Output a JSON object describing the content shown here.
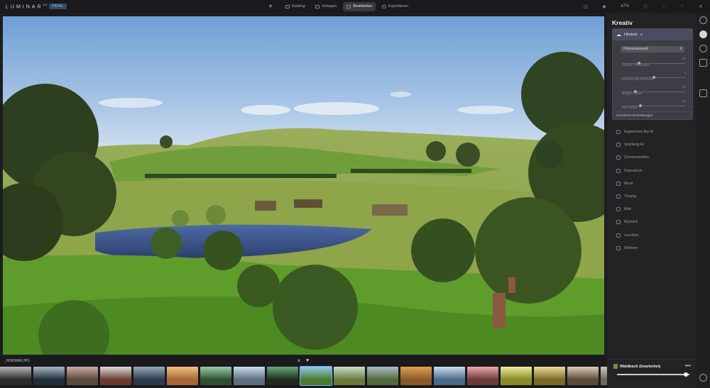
{
  "app": {
    "logo": "LUMINAR",
    "version": "4.3",
    "trial_badge": "TRIAL"
  },
  "topnav": {
    "add_label": "+",
    "tabs": [
      {
        "label": "Katalog"
      },
      {
        "label": "Vorlagen"
      },
      {
        "label": "Bearbeiten",
        "active": true
      },
      {
        "label": "Exportieren"
      }
    ]
  },
  "toolbar_right": {
    "zoom": "47%"
  },
  "filmstrip": {
    "filename": "_HDR3849.JPG",
    "close_label": "✕",
    "heart_label": "♥",
    "thumb_count": 19,
    "selected_index": 9
  },
  "panel": {
    "title": "Kreativ",
    "sky_module": {
      "title": "Himmel",
      "title_ai": "AI",
      "select_value": "Himmelauswahl",
      "sliders": [
        {
          "label": "Himmel Verblenden",
          "value": "25",
          "fraction": 0.25
        },
        {
          "label": "Position des Horizonts",
          "value": "0",
          "fraction": 0.5
        },
        {
          "label": "Relight Szene",
          "value": "20",
          "fraction": 0.2
        },
        {
          "label": "Sky Global",
          "value": "20",
          "fraction": 0.28
        }
      ],
      "advanced_label": "Erweiterte Einstellungen"
    },
    "tools": [
      {
        "label": "Augmented Sky AI"
      },
      {
        "label": "Strahlung AI"
      },
      {
        "label": "Sonnenstrahlen"
      },
      {
        "label": "Dramatisch"
      },
      {
        "label": "Mood"
      },
      {
        "label": "Tönung"
      },
      {
        "label": "Matt"
      },
      {
        "label": "Mystisch"
      },
      {
        "label": "Leuchten"
      },
      {
        "label": "Filmkorn"
      }
    ],
    "preset": {
      "name": "Waldbach (bearbeitet)",
      "menu": "•••",
      "amount_fraction": 0.97
    }
  },
  "colors": {
    "accent": "#6fb0ff",
    "panel_bg": "#232326",
    "sky_module_bg": "#3d3d46",
    "topbar_bg": "#1a1a1c"
  }
}
